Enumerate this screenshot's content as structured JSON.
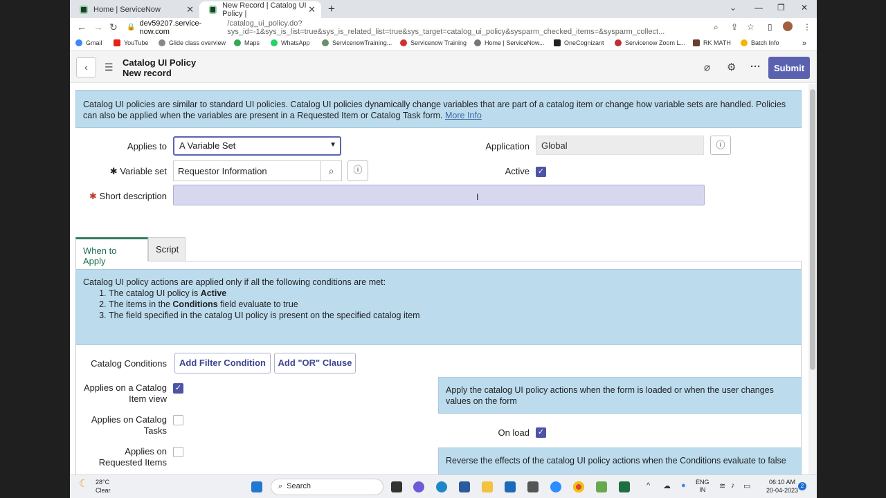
{
  "browser": {
    "tabs": [
      {
        "title": "Home | ServiceNow"
      },
      {
        "title": "New Record | Catalog UI Policy | "
      }
    ],
    "url_domain": "dev59207.service-now.com",
    "url_rest": "/catalog_ui_policy.do?sys_id=-1&sys_is_list=true&sys_is_related_list=true&sys_target=catalog_ui_policy&sysparm_checked_items=&sysparm_collect...",
    "bookmarks": [
      "Gmail",
      "YouTube",
      "Glide class overview",
      "Maps",
      "WhatsApp",
      "ServicenowTraining...",
      "Servicenow Training",
      "Home | ServiceNow...",
      "OneCognizant",
      "Servicenow Zoom L...",
      "RK MATH",
      "Batch Info"
    ]
  },
  "header": {
    "title": "Catalog UI Policy",
    "subtitle": "New record",
    "submit_label": "Submit"
  },
  "top_info": {
    "text": "Catalog UI policies are similar to standard UI policies. Catalog UI policies dynamically change variables that are part of a catalog item or change how variable sets are handled. Policies can also be applied when the variables are present in a Requested Item or Catalog Task form.",
    "link": "More Info"
  },
  "form": {
    "applies_to_label": "Applies to",
    "applies_to_value": "A Variable Set",
    "application_label": "Application",
    "application_value": "Global",
    "variable_set_label": "Variable set",
    "variable_set_value": "Requestor Information",
    "active_label": "Active",
    "active_checked": true,
    "short_description_label": "Short description",
    "short_description_value": ""
  },
  "tabs": [
    {
      "label": "When to Apply"
    },
    {
      "label": "Script"
    }
  ],
  "conditions_info": {
    "intro": "Catalog UI policy actions are applied only if all the following conditions are met:",
    "items": [
      {
        "pre": "The catalog UI policy is ",
        "bold": "Active",
        "post": ""
      },
      {
        "pre": "The items in the ",
        "bold": "Conditions",
        "post": " field evaluate to true"
      },
      {
        "pre": "The field specified in the catalog UI policy is present on the specified catalog item",
        "bold": "",
        "post": ""
      }
    ]
  },
  "catalog_conditions": {
    "label": "Catalog Conditions",
    "add_filter": "Add Filter Condition",
    "add_or": "Add \"OR\" Clause"
  },
  "applies_options": [
    {
      "label1": "Applies on a Catalog",
      "label2": "Item view",
      "checked": true
    },
    {
      "label1": "Applies on Catalog",
      "label2": "Tasks",
      "checked": false
    },
    {
      "label1": "Applies on",
      "label2": "Requested Items",
      "checked": false
    }
  ],
  "side": {
    "info1": "Apply the catalog UI policy actions when the form is loaded or when the user changes values on the form",
    "on_load_label": "On load",
    "on_load_checked": true,
    "info2": "Reverse the effects of the catalog UI policy actions when the Conditions evaluate to false"
  },
  "taskbar": {
    "temp": "28°C",
    "weather": "Clear",
    "search": "Search",
    "lang1": "ENG",
    "lang2": "IN",
    "time": "06:10 AM",
    "date": "20-04-2023",
    "badge": "2"
  }
}
